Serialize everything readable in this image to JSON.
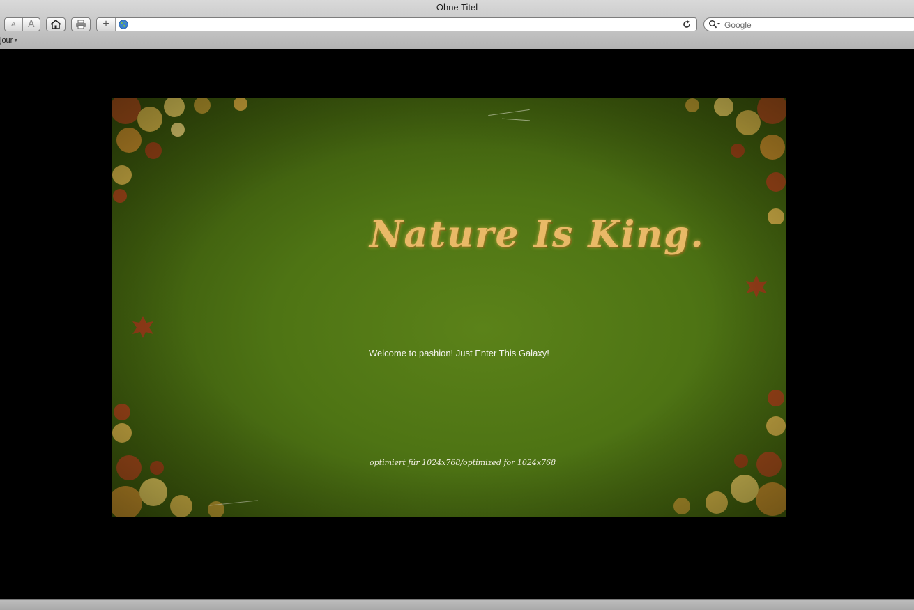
{
  "window": {
    "title": "Ohne Titel"
  },
  "toolbar": {
    "font_smaller_label": "A",
    "font_larger_label": "A",
    "home_icon": "home-icon",
    "print_icon": "print-icon",
    "add_bookmark_label": "+",
    "address_value": "",
    "search_placeholder": "Google"
  },
  "bookmarks_bar": {
    "items": [
      {
        "label": "jour"
      }
    ]
  },
  "page": {
    "title": "Nature Is King.",
    "welcome_text": "Welcome to pashion! Just Enter This Galaxy!",
    "optimized_text": "optimiert für 1024x768/optimized for 1024x768",
    "colors": {
      "background": "#000000",
      "banner_green": "#4e7414",
      "title_gold": "#e9b967"
    }
  }
}
